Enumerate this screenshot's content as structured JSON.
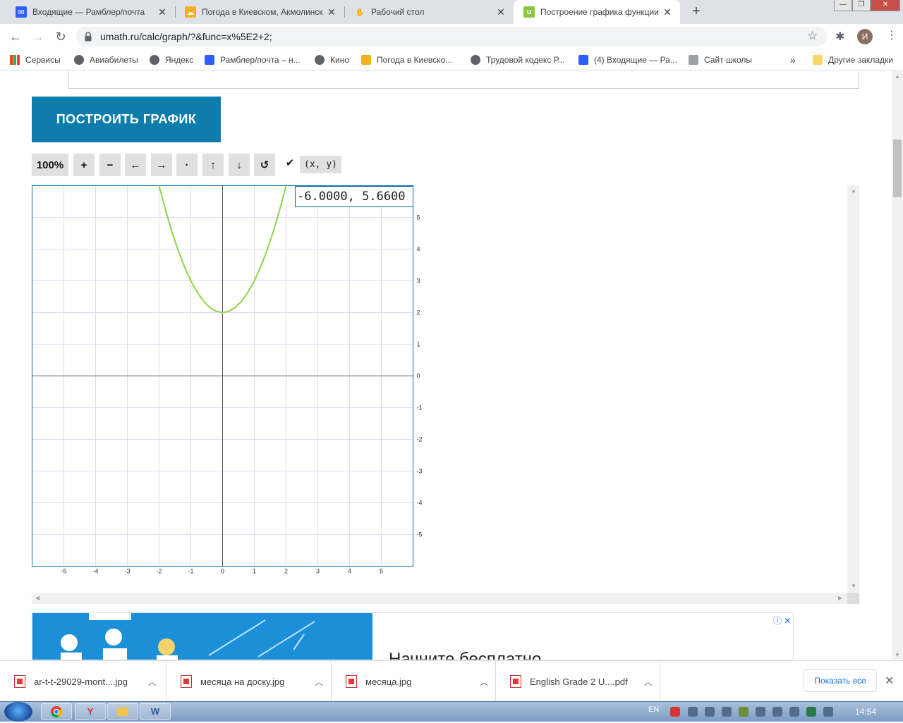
{
  "browser": {
    "tabs": [
      {
        "title": "Входящие — Рамблер/почта",
        "icon": "mail-icon",
        "active": false
      },
      {
        "title": "Погода в Киевском, Акмолинск",
        "icon": "weather-icon",
        "active": false
      },
      {
        "title": "Рабочий стол",
        "icon": "desktop-icon",
        "active": false
      },
      {
        "title": "Построение графика функции о",
        "icon": "umath-icon",
        "favicon_letter": "u",
        "active": true
      }
    ],
    "url": "umath.ru/calc/graph/?&func=x%5E2+2;",
    "avatar_letter": "И",
    "bookmarks": [
      {
        "label": "Сервисы",
        "icon": "apps-icon"
      },
      {
        "label": "Авиабилеты",
        "icon": "globe-icon"
      },
      {
        "label": "Яндекс",
        "icon": "globe-icon"
      },
      {
        "label": "Рамблер/почта – н...",
        "icon": "mail-icon"
      },
      {
        "label": "Кино",
        "icon": "globe-icon"
      },
      {
        "label": "Погода в Киевско...",
        "icon": "weather-icon"
      },
      {
        "label": "Трудовой кодекс Р...",
        "icon": "globe-icon"
      },
      {
        "label": "(4) Входящие — Ра...",
        "icon": "mail-icon"
      },
      {
        "label": "Сайт школы",
        "icon": "shield-icon"
      }
    ],
    "bookmarks_overflow": "»",
    "other_bookmarks": "Другие закладки"
  },
  "page": {
    "plot_button": "ПОСТРОИТЬ ГРАФИК",
    "controls": [
      {
        "label": "100%",
        "name": "zoom-reset-button"
      },
      {
        "label": "+",
        "name": "zoom-in-button"
      },
      {
        "label": "−",
        "name": "zoom-out-button"
      },
      {
        "label": "←",
        "name": "pan-left-button"
      },
      {
        "label": "→",
        "name": "pan-right-button"
      },
      {
        "label": "·",
        "name": "center-button"
      },
      {
        "label": "↑",
        "name": "pan-up-button"
      },
      {
        "label": "↓",
        "name": "pan-down-button"
      },
      {
        "label": "↺",
        "name": "reset-button"
      }
    ],
    "coord_checkbox_mark": "✔",
    "coord_toggle_label": "(x, y)",
    "coord_readout": "-6.0000, 5.6600",
    "ad": {
      "headline": "Начните бесплатно",
      "info_icons": "ⓘ ✕"
    }
  },
  "chart_data": {
    "type": "line",
    "function": "x^2+2",
    "xlim": [
      -6,
      6
    ],
    "ylim": [
      -6,
      6
    ],
    "x_ticks": [
      -5,
      -4,
      -3,
      -2,
      -1,
      0,
      1,
      2,
      3,
      4,
      5
    ],
    "y_ticks": [
      -5,
      -4,
      -3,
      -2,
      -1,
      0,
      1,
      2,
      3,
      4,
      5
    ],
    "grid": true,
    "series": [
      {
        "color": "#8fd44a",
        "x": [
          -2,
          -1.8,
          -1.6,
          -1.4,
          -1.2,
          -1,
          -0.8,
          -0.6,
          -0.4,
          -0.2,
          0,
          0.2,
          0.4,
          0.6,
          0.8,
          1,
          1.2,
          1.4,
          1.6,
          1.8,
          2
        ],
        "y": [
          6,
          5.24,
          4.56,
          3.96,
          3.44,
          3,
          2.64,
          2.36,
          2.16,
          2.04,
          2,
          2.04,
          2.16,
          2.36,
          2.64,
          3,
          3.44,
          3.96,
          4.56,
          5.24,
          6
        ]
      }
    ]
  },
  "downloads": {
    "items": [
      {
        "name": "ar-t-t-29029-mont....jpg"
      },
      {
        "name": "месяца на доску.jpg"
      },
      {
        "name": "месяца.jpg"
      },
      {
        "name": "English Grade 2 U....pdf"
      }
    ],
    "show_all": "Показать все"
  },
  "taskbar": {
    "language": "EN",
    "clock": "14:54"
  }
}
